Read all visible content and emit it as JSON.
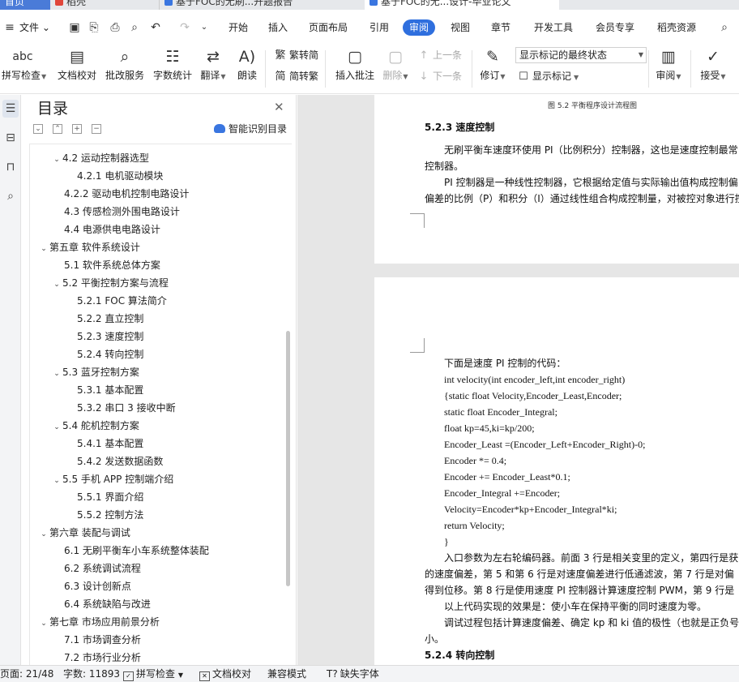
{
  "tabs": [
    {
      "label": "首页"
    },
    {
      "label": "稻壳"
    },
    {
      "label": "基于FOC的无刷...开题报告"
    },
    {
      "label": "基于FOC的无...设计-毕业论文"
    }
  ],
  "menu": {
    "file": "文件",
    "items": [
      "开始",
      "插入",
      "页面布局",
      "引用",
      "审阅",
      "视图",
      "章节",
      "开发工具",
      "会员专享",
      "稻壳资源"
    ],
    "active": "审阅"
  },
  "ribbon": {
    "spell_check": "拼写检查",
    "doc_proof": "文档校对",
    "batch_service": "批改服务",
    "word_count": "字数统计",
    "translate": "翻译",
    "read_aloud": "朗读",
    "trad_to_simp": "繁转简",
    "simp_to_trad": "简转繁",
    "insert_comment": "插入批注",
    "delete": "删除",
    "prev": "上一条",
    "next": "下一条",
    "revise": "修订",
    "markup_state": "显示标记的最终状态",
    "show_markup": "显示标记",
    "review": "审阅",
    "accept": "接受"
  },
  "toc": {
    "title": "目录",
    "smart_label": "智能识别目录",
    "items": [
      {
        "label": "4.2 运动控制器选型",
        "level": 2,
        "chevron": true
      },
      {
        "label": "4.2.1 电机驱动模块",
        "level": 3,
        "chevron": false
      },
      {
        "label": "4.2.2 驱动电机控制电路设计",
        "level": 2,
        "chevron": false
      },
      {
        "label": "4.3 传感检测外围电路设计",
        "level": 2,
        "chevron": false
      },
      {
        "label": "4.4 电源供电电路设计",
        "level": 2,
        "chevron": false
      },
      {
        "label": "第五章 软件系统设计",
        "level": 1,
        "chevron": true
      },
      {
        "label": "5.1 软件系统总体方案",
        "level": 2,
        "chevron": false
      },
      {
        "label": "5.2 平衡控制方案与流程",
        "level": 2,
        "chevron": true
      },
      {
        "label": "5.2.1 FOC 算法简介",
        "level": 3,
        "chevron": false
      },
      {
        "label": "5.2.2 直立控制",
        "level": 3,
        "chevron": false
      },
      {
        "label": "5.2.3 速度控制",
        "level": 3,
        "chevron": false
      },
      {
        "label": "5.2.4 转向控制",
        "level": 3,
        "chevron": false
      },
      {
        "label": "5.3 蓝牙控制方案",
        "level": 2,
        "chevron": true
      },
      {
        "label": "5.3.1 基本配置",
        "level": 3,
        "chevron": false
      },
      {
        "label": "5.3.2 串口 3 接收中断",
        "level": 3,
        "chevron": false
      },
      {
        "label": "5.4 舵机控制方案",
        "level": 2,
        "chevron": true
      },
      {
        "label": "5.4.1 基本配置",
        "level": 3,
        "chevron": false
      },
      {
        "label": "5.4.2 发送数据函数",
        "level": 3,
        "chevron": false
      },
      {
        "label": "5.5 手机 APP 控制端介绍",
        "level": 2,
        "chevron": true
      },
      {
        "label": "5.5.1 界面介绍",
        "level": 3,
        "chevron": false
      },
      {
        "label": "5.5.2 控制方法",
        "level": 3,
        "chevron": false
      },
      {
        "label": "第六章 装配与调试",
        "level": 1,
        "chevron": true
      },
      {
        "label": "6.1 无刷平衡车小车系统整体装配",
        "level": 2,
        "chevron": false
      },
      {
        "label": "6.2 系统调试流程",
        "level": 2,
        "chevron": false
      },
      {
        "label": "6.3 设计创新点",
        "level": 2,
        "chevron": false
      },
      {
        "label": "6.4 系统缺陷与改进",
        "level": 2,
        "chevron": false
      },
      {
        "label": "第七章 市场应用前景分析",
        "level": 1,
        "chevron": true
      },
      {
        "label": "7.1 市场调查分析",
        "level": 2,
        "chevron": false
      },
      {
        "label": "7.2 市场行业分析",
        "level": 2,
        "chevron": false
      }
    ]
  },
  "doc": {
    "page1": {
      "caption": "图 5.2 平衡程序设计流程图",
      "heading": "5.2.3 速度控制",
      "lines": [
        "无刷平衡车速度环使用 PI（比例积分）控制器，这也是速度控制最常",
        "控制器。",
        "PI 控制器是一种线性控制器，它根据给定值与实际输出值构成控制偏",
        "偏差的比例（P）和积分（I）通过线性组合构成控制量，对被控对象进行控"
      ]
    },
    "page2": {
      "intro": "下面是速度 PI 控制的代码：",
      "code": [
        "int velocity(int encoder_left,int encoder_right)",
        "{static float Velocity,Encoder_Least,Encoder;",
        "static float Encoder_Integral;",
        "float kp=45,ki=kp/200;",
        "Encoder_Least =(Encoder_Left+Encoder_Right)-0;",
        "Encoder *= 0.4;",
        "Encoder += Encoder_Least*0.1;",
        "Encoder_Integral +=Encoder;",
        "Velocity=Encoder*kp+Encoder_Integral*ki;",
        "return Velocity;",
        "}"
      ],
      "para_lines": [
        "入口参数为左右轮编码器。前面 3 行是相关变里的定义，第四行是获",
        "的速度偏差，第 5 和第 6 行是对速度偏差进行低通滤波，第 7 行是对偏",
        "得到位移。第 8 行是使用速度 PI 控制器计算速度控制 PWM，第 9 行是",
        "以上代码实现的效果是：使小车在保持平衡的同时速度为零。",
        "调试过程包括计算速度偏差、确定 kp 和 ki 值的极性（也就是正负号",
        "小。",
        "5.2.4 转向控制"
      ]
    }
  },
  "status": {
    "page": "页面: 21/48",
    "words": "字数: 11893",
    "spell": "拼写检查",
    "proof": "文档校对",
    "compat": "兼容模式",
    "missing_font": "缺失字体"
  }
}
